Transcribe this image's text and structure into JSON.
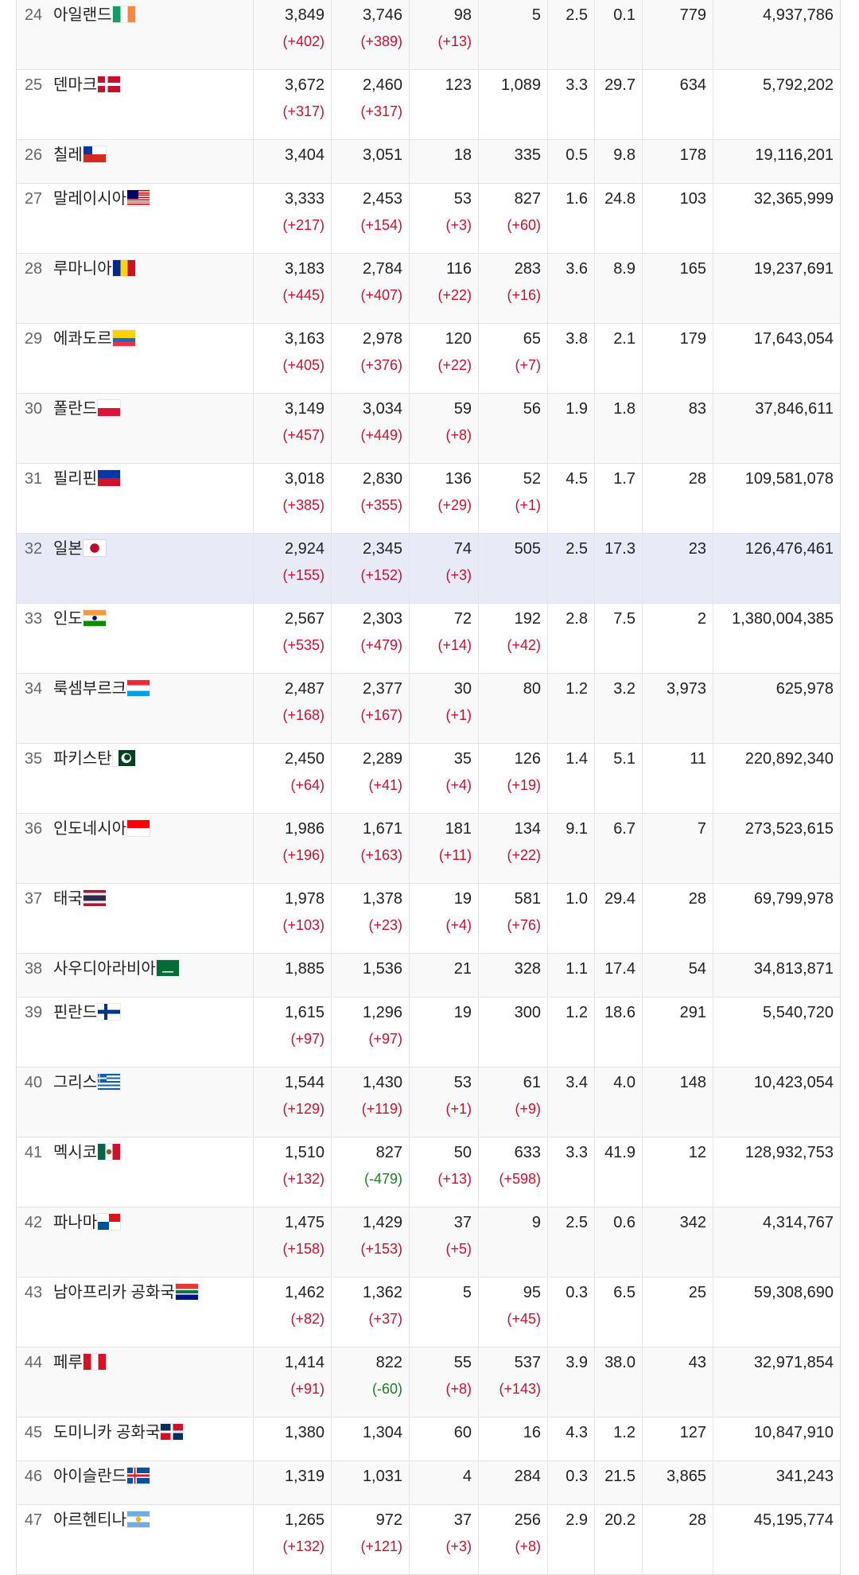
{
  "rows": [
    {
      "rank": "24",
      "country": "아일랜드",
      "flag": "ireland-flag",
      "total": "3,849",
      "total_delta": "(+402)",
      "active": "3,746",
      "active_delta": "(+389)",
      "deaths": "98",
      "deaths_delta": "(+13)",
      "recovered": "5",
      "recovered_delta": "",
      "fatality": "2.5",
      "recovery": "0.1",
      "density": "779",
      "population": "4,937,786"
    },
    {
      "rank": "25",
      "country": "덴마크",
      "flag": "denmark-flag",
      "total": "3,672",
      "total_delta": "(+317)",
      "active": "2,460",
      "active_delta": "(+317)",
      "deaths": "123",
      "deaths_delta": "",
      "recovered": "1,089",
      "recovered_delta": "",
      "fatality": "3.3",
      "recovery": "29.7",
      "density": "634",
      "population": "5,792,202"
    },
    {
      "rank": "26",
      "country": "칠레",
      "flag": "chile-flag",
      "total": "3,404",
      "total_delta": "",
      "active": "3,051",
      "active_delta": "",
      "deaths": "18",
      "deaths_delta": "",
      "recovered": "335",
      "recovered_delta": "",
      "fatality": "0.5",
      "recovery": "9.8",
      "density": "178",
      "population": "19,116,201"
    },
    {
      "rank": "27",
      "country": "말레이시아",
      "flag": "malaysia-flag",
      "total": "3,333",
      "total_delta": "(+217)",
      "active": "2,453",
      "active_delta": "(+154)",
      "deaths": "53",
      "deaths_delta": "(+3)",
      "recovered": "827",
      "recovered_delta": "(+60)",
      "fatality": "1.6",
      "recovery": "24.8",
      "density": "103",
      "population": "32,365,999"
    },
    {
      "rank": "28",
      "country": "루마니아",
      "flag": "romania-flag",
      "total": "3,183",
      "total_delta": "(+445)",
      "active": "2,784",
      "active_delta": "(+407)",
      "deaths": "116",
      "deaths_delta": "(+22)",
      "recovered": "283",
      "recovered_delta": "(+16)",
      "fatality": "3.6",
      "recovery": "8.9",
      "density": "165",
      "population": "19,237,691"
    },
    {
      "rank": "29",
      "country": "에콰도르",
      "flag": "ecuador-flag",
      "total": "3,163",
      "total_delta": "(+405)",
      "active": "2,978",
      "active_delta": "(+376)",
      "deaths": "120",
      "deaths_delta": "(+22)",
      "recovered": "65",
      "recovered_delta": "(+7)",
      "fatality": "3.8",
      "recovery": "2.1",
      "density": "179",
      "population": "17,643,054"
    },
    {
      "rank": "30",
      "country": "폴란드",
      "flag": "poland-flag",
      "total": "3,149",
      "total_delta": "(+457)",
      "active": "3,034",
      "active_delta": "(+449)",
      "deaths": "59",
      "deaths_delta": "(+8)",
      "recovered": "56",
      "recovered_delta": "",
      "fatality": "1.9",
      "recovery": "1.8",
      "density": "83",
      "population": "37,846,611"
    },
    {
      "rank": "31",
      "country": "필리핀",
      "flag": "philippines-flag",
      "total": "3,018",
      "total_delta": "(+385)",
      "active": "2,830",
      "active_delta": "(+355)",
      "deaths": "136",
      "deaths_delta": "(+29)",
      "recovered": "52",
      "recovered_delta": "(+1)",
      "fatality": "4.5",
      "recovery": "1.7",
      "density": "28",
      "population": "109,581,078"
    },
    {
      "rank": "32",
      "country": "일본",
      "flag": "japan-flag",
      "total": "2,924",
      "total_delta": "(+155)",
      "active": "2,345",
      "active_delta": "(+152)",
      "deaths": "74",
      "deaths_delta": "(+3)",
      "recovered": "505",
      "recovered_delta": "",
      "fatality": "2.5",
      "recovery": "17.3",
      "density": "23",
      "population": "126,476,461"
    },
    {
      "rank": "33",
      "country": "인도",
      "flag": "india-flag",
      "total": "2,567",
      "total_delta": "(+535)",
      "active": "2,303",
      "active_delta": "(+479)",
      "deaths": "72",
      "deaths_delta": "(+14)",
      "recovered": "192",
      "recovered_delta": "(+42)",
      "fatality": "2.8",
      "recovery": "7.5",
      "density": "2",
      "population": "1,380,004,385"
    },
    {
      "rank": "34",
      "country": "룩셈부르크",
      "flag": "luxembourg-flag",
      "total": "2,487",
      "total_delta": "(+168)",
      "active": "2,377",
      "active_delta": "(+167)",
      "deaths": "30",
      "deaths_delta": "(+1)",
      "recovered": "80",
      "recovered_delta": "",
      "fatality": "1.2",
      "recovery": "3.2",
      "density": "3,973",
      "population": "625,978"
    },
    {
      "rank": "35",
      "country": "파키스탄",
      "flag": "pakistan-flag",
      "total": "2,450",
      "total_delta": "(+64)",
      "active": "2,289",
      "active_delta": "(+41)",
      "deaths": "35",
      "deaths_delta": "(+4)",
      "recovered": "126",
      "recovered_delta": "(+19)",
      "fatality": "1.4",
      "recovery": "5.1",
      "density": "11",
      "population": "220,892,340"
    },
    {
      "rank": "36",
      "country": "인도네시아",
      "flag": "indonesia-flag",
      "total": "1,986",
      "total_delta": "(+196)",
      "active": "1,671",
      "active_delta": "(+163)",
      "deaths": "181",
      "deaths_delta": "(+11)",
      "recovered": "134",
      "recovered_delta": "(+22)",
      "fatality": "9.1",
      "recovery": "6.7",
      "density": "7",
      "population": "273,523,615"
    },
    {
      "rank": "37",
      "country": "태국",
      "flag": "thailand-flag",
      "total": "1,978",
      "total_delta": "(+103)",
      "active": "1,378",
      "active_delta": "(+23)",
      "deaths": "19",
      "deaths_delta": "(+4)",
      "recovered": "581",
      "recovered_delta": "(+76)",
      "fatality": "1.0",
      "recovery": "29.4",
      "density": "28",
      "population": "69,799,978"
    },
    {
      "rank": "38",
      "country": "사우디아라비아",
      "flag": "saudi-arabia-flag",
      "total": "1,885",
      "total_delta": "",
      "active": "1,536",
      "active_delta": "",
      "deaths": "21",
      "deaths_delta": "",
      "recovered": "328",
      "recovered_delta": "",
      "fatality": "1.1",
      "recovery": "17.4",
      "density": "54",
      "population": "34,813,871"
    },
    {
      "rank": "39",
      "country": "핀란드",
      "flag": "finland-flag",
      "total": "1,615",
      "total_delta": "(+97)",
      "active": "1,296",
      "active_delta": "(+97)",
      "deaths": "19",
      "deaths_delta": "",
      "recovered": "300",
      "recovered_delta": "",
      "fatality": "1.2",
      "recovery": "18.6",
      "density": "291",
      "population": "5,540,720"
    },
    {
      "rank": "40",
      "country": "그리스",
      "flag": "greece-flag",
      "total": "1,544",
      "total_delta": "(+129)",
      "active": "1,430",
      "active_delta": "(+119)",
      "deaths": "53",
      "deaths_delta": "(+1)",
      "recovered": "61",
      "recovered_delta": "(+9)",
      "fatality": "3.4",
      "recovery": "4.0",
      "density": "148",
      "population": "10,423,054"
    },
    {
      "rank": "41",
      "country": "멕시코",
      "flag": "mexico-flag",
      "total": "1,510",
      "total_delta": "(+132)",
      "active": "827",
      "active_delta": "(-479)",
      "deaths": "50",
      "deaths_delta": "(+13)",
      "recovered": "633",
      "recovered_delta": "(+598)",
      "fatality": "3.3",
      "recovery": "41.9",
      "density": "12",
      "population": "128,932,753"
    },
    {
      "rank": "42",
      "country": "파나마",
      "flag": "panama-flag",
      "total": "1,475",
      "total_delta": "(+158)",
      "active": "1,429",
      "active_delta": "(+153)",
      "deaths": "37",
      "deaths_delta": "(+5)",
      "recovered": "9",
      "recovered_delta": "",
      "fatality": "2.5",
      "recovery": "0.6",
      "density": "342",
      "population": "4,314,767"
    },
    {
      "rank": "43",
      "country": "남아프리카 공화국",
      "flag": "south-africa-flag",
      "total": "1,462",
      "total_delta": "(+82)",
      "active": "1,362",
      "active_delta": "(+37)",
      "deaths": "5",
      "deaths_delta": "",
      "recovered": "95",
      "recovered_delta": "(+45)",
      "fatality": "0.3",
      "recovery": "6.5",
      "density": "25",
      "population": "59,308,690"
    },
    {
      "rank": "44",
      "country": "페루",
      "flag": "peru-flag",
      "total": "1,414",
      "total_delta": "(+91)",
      "active": "822",
      "active_delta": "(-60)",
      "deaths": "55",
      "deaths_delta": "(+8)",
      "recovered": "537",
      "recovered_delta": "(+143)",
      "fatality": "3.9",
      "recovery": "38.0",
      "density": "43",
      "population": "32,971,854"
    },
    {
      "rank": "45",
      "country": "도미니카 공화국",
      "flag": "dominican-republic-flag",
      "total": "1,380",
      "total_delta": "",
      "active": "1,304",
      "active_delta": "",
      "deaths": "60",
      "deaths_delta": "",
      "recovered": "16",
      "recovered_delta": "",
      "fatality": "4.3",
      "recovery": "1.2",
      "density": "127",
      "population": "10,847,910"
    },
    {
      "rank": "46",
      "country": "아이슬란드",
      "flag": "iceland-flag",
      "total": "1,319",
      "total_delta": "",
      "active": "1,031",
      "active_delta": "",
      "deaths": "4",
      "deaths_delta": "",
      "recovered": "284",
      "recovered_delta": "",
      "fatality": "0.3",
      "recovery": "21.5",
      "density": "3,865",
      "population": "341,243"
    },
    {
      "rank": "47",
      "country": "아르헨티나",
      "flag": "argentina-flag",
      "total": "1,265",
      "total_delta": "(+132)",
      "active": "972",
      "active_delta": "(+121)",
      "deaths": "37",
      "deaths_delta": "(+3)",
      "recovered": "256",
      "recovered_delta": "(+8)",
      "fatality": "2.9",
      "recovery": "20.2",
      "density": "28",
      "population": "45,195,774"
    }
  ],
  "highlight_rank": "32",
  "colors": {
    "increase": "#c8102e",
    "decrease": "#1e7d22",
    "highlight_row": "#e8eaf8",
    "alt_row": "#f9f9f9"
  }
}
